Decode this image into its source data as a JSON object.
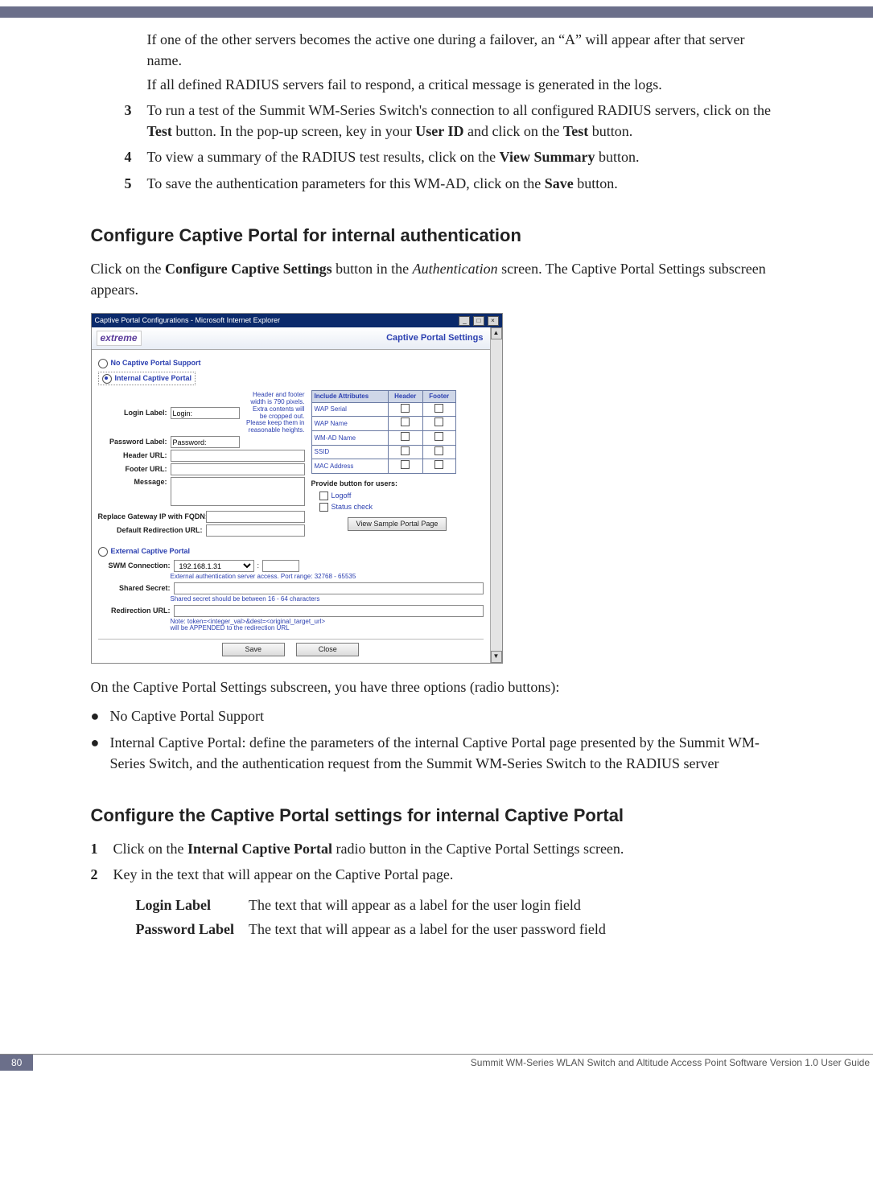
{
  "intro": {
    "p1": "If one of the other servers becomes the active one during a failover, an “A” will appear after that server name.",
    "p2": "If all defined RADIUS servers fail to respond, a critical message is generated in the logs."
  },
  "steps_top": [
    {
      "n": "3",
      "t_before": "To run a test of the Summit WM-Series Switch's connection to all configured RADIUS servers, click on the ",
      "b1": "Test",
      "t_mid": " button. In the pop-up screen, key in your ",
      "b2": "User ID",
      "t_mid2": " and click on the ",
      "b3": "Test",
      "t_after": " button."
    },
    {
      "n": "4",
      "t_before": "To view a summary of the RADIUS test results, click on the ",
      "b1": "View Summary",
      "t_after": " button."
    },
    {
      "n": "5",
      "t_before": "To save the authentication parameters for this WM-AD, click on the ",
      "b1": "Save",
      "t_after": " button."
    }
  ],
  "h2a": "Configure Captive Portal for internal authentication",
  "p_click": {
    "pre": "Click on the ",
    "b": "Configure Captive Settings",
    "mid": " button in the ",
    "i": "Authentication",
    "post": " screen. The Captive Portal Settings subscreen appears."
  },
  "screenshot": {
    "title": "Captive Portal Configurations - Microsoft Internet Explorer",
    "brand": "extreme",
    "brandRight": "Captive Portal Settings",
    "radio_no": "No Captive Portal Support",
    "radio_int": "Internal Captive Portal",
    "radio_ext": "External Captive Portal",
    "labels": {
      "login": "Login Label:",
      "login_val": "Login:",
      "password": "Password Label:",
      "password_val": "Password:",
      "header": "Header URL:",
      "footerUrl": "Footer URL:",
      "message": "Message:",
      "replace": "Replace Gateway IP with FQDN:",
      "defred": "Default Redirection URL:",
      "swm": "SWM Connection:",
      "swm_val": "192.168.1.31",
      "shared": "Shared Secret:",
      "redir": "Redirection URL:"
    },
    "hint": "Header and footer width is 790 pixels. Extra contents will be cropped out. Please keep them in reasonable heights.",
    "attr_h": [
      "Include Attributes",
      "Header",
      "Footer"
    ],
    "attrs": [
      "WAP Serial",
      "WAP Name",
      "WM-AD Name",
      "SSID",
      "MAC Address"
    ],
    "provide": "Provide button for users:",
    "chk1": "Logoff",
    "chk2": "Status check",
    "viewbtn": "View Sample Portal Page",
    "note_ext1": "External authentication server access. Port range: 32768 - 65535",
    "note_ext2": "Shared secret should be between 16 - 64 characters",
    "note_ext3a": "Note: token=<integer_val>&dest=<original_target_url>",
    "note_ext3b": "will be APPENDED to the redirection URL",
    "save": "Save",
    "close": "Close"
  },
  "p_after_shot": "On the Captive Portal Settings subscreen, you have three options (radio buttons):",
  "bullets": [
    "No Captive Portal Support",
    "Internal Captive Portal: define the parameters of the internal Captive Portal page presented by the Summit WM-Series Switch, and the authentication request from the Summit WM-Series Switch to the RADIUS server"
  ],
  "h2b": "Configure the Captive Portal settings for internal Captive Portal",
  "steps_bottom": [
    {
      "n": "1",
      "pre": "Click on the ",
      "b": "Internal Captive Portal",
      "post": " radio button in the Captive Portal Settings screen."
    },
    {
      "n": "2",
      "t": "Key in the text that will appear on the Captive Portal page."
    }
  ],
  "defs": [
    {
      "k": "Login Label",
      "v": "The text that will appear as a label for the user login field"
    },
    {
      "k": "Password Label",
      "v": "The text that will appear as a label for the user password field"
    }
  ],
  "footer": {
    "page": "80",
    "guide": "Summit WM-Series WLAN Switch and Altitude Access Point Software Version 1.0 User Guide"
  }
}
